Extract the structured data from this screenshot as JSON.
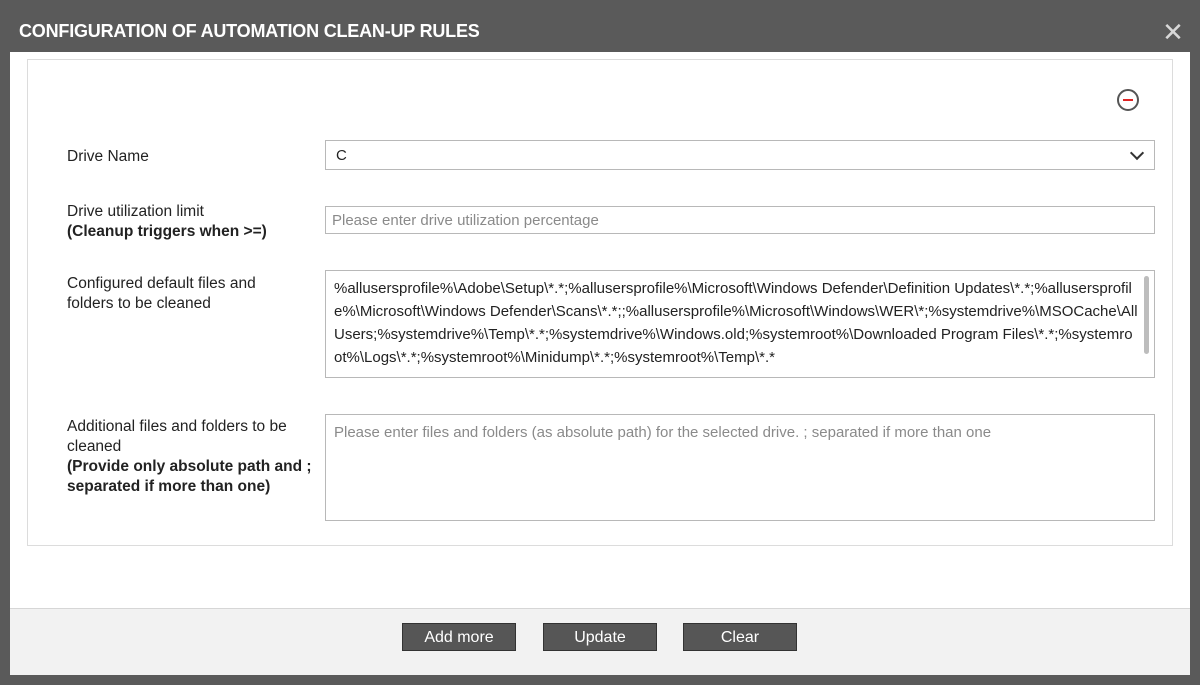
{
  "dialog": {
    "title": "CONFIGURATION OF AUTOMATION CLEAN-UP RULES",
    "close_glyph": "✕"
  },
  "form": {
    "drive_name": {
      "label": "Drive Name",
      "value": "C"
    },
    "utilization": {
      "label": "Drive utilization limit",
      "sublabel": "(Cleanup triggers when >=)",
      "placeholder": "Please enter drive utilization percentage"
    },
    "configured": {
      "label": "Configured default files and folders to be cleaned",
      "value": "%allusersprofile%\\Adobe\\Setup\\*.*;%allusersprofile%\\Microsoft\\Windows Defender\\Definition Updates\\*.*;%allusersprofile%\\Microsoft\\Windows Defender\\Scans\\*.*;;%allusersprofile%\\Microsoft\\Windows\\WER\\*;%systemdrive%\\MSOCache\\All Users;%systemdrive%\\Temp\\*.*;%systemdrive%\\Windows.old;%systemroot%\\Downloaded Program Files\\*.*;%systemroot%\\Logs\\*.*;%systemroot%\\Minidump\\*.*;%systemroot%\\Temp\\*.*"
    },
    "additional": {
      "label": "Additional files and folders to be cleaned",
      "sublabel": "(Provide only absolute path and ; separated if more than one)",
      "placeholder": "Please enter files and folders (as absolute path) for the selected drive. ; separated if more than one"
    }
  },
  "footer": {
    "add_more": "Add more",
    "update": "Update",
    "clear": "Clear"
  },
  "colors": {
    "titlebar": "#5a5a5a",
    "button": "#565656",
    "remove_icon_accent": "#e02424"
  }
}
